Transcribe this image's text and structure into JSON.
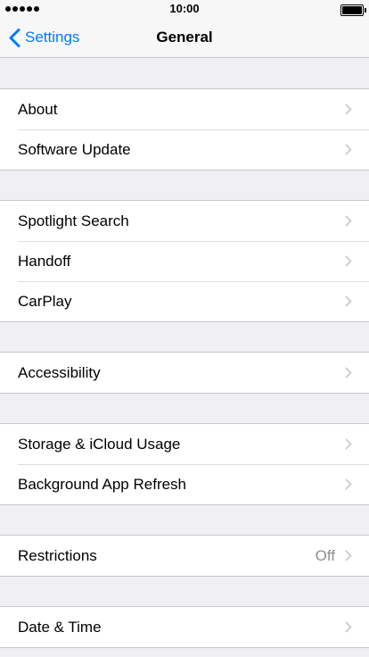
{
  "status_bar": {
    "time": "10:00",
    "signal_dots": 5
  },
  "nav": {
    "back_label": "Settings",
    "title": "General"
  },
  "colors": {
    "accent": "#007aff",
    "background": "#efeff4",
    "secondary_text": "#8e8e93",
    "chevron": "#c7c7cc"
  },
  "groups": [
    {
      "rows": [
        {
          "label": "About"
        },
        {
          "label": "Software Update"
        }
      ]
    },
    {
      "rows": [
        {
          "label": "Spotlight Search"
        },
        {
          "label": "Handoff"
        },
        {
          "label": "CarPlay"
        }
      ]
    },
    {
      "rows": [
        {
          "label": "Accessibility"
        }
      ]
    },
    {
      "rows": [
        {
          "label": "Storage & iCloud Usage"
        },
        {
          "label": "Background App Refresh"
        }
      ]
    },
    {
      "rows": [
        {
          "label": "Restrictions",
          "value": "Off"
        }
      ]
    },
    {
      "rows": [
        {
          "label": "Date & Time"
        }
      ]
    }
  ]
}
